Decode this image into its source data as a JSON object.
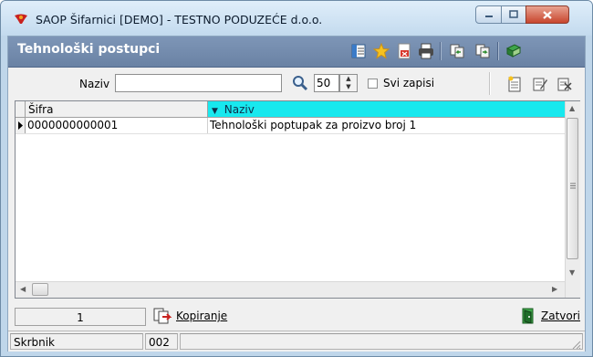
{
  "window": {
    "title": "SAOP Šifarnici [DEMO] - TESTNO PODUZEĆE d.o.o."
  },
  "header": {
    "title": "Tehnološki postupci"
  },
  "toolbar_icons": [
    "list-columns-icon",
    "star-icon",
    "pdf-icon",
    "printer-icon",
    "copy-left-icon",
    "copy-right-icon",
    "exit-book-icon"
  ],
  "filter": {
    "naziv_label": "Naziv",
    "naziv_value": "",
    "limit_value": "50",
    "svi_zapisi_label": "Svi zapisi",
    "svi_zapisi_checked": false
  },
  "grid": {
    "columns": [
      "Šifra",
      "Naziv"
    ],
    "sort_column": "Naziv",
    "sort_indicator": "▼",
    "rows": [
      {
        "sifra": "0000000000001",
        "naziv": "Tehnološki poptupak za proizvo broj 1"
      }
    ]
  },
  "bottom": {
    "record_number": "1",
    "kopiranje_label": "Kopiranje",
    "zatvori_label": "Zatvori"
  },
  "status": {
    "cell1": "Skrbnik",
    "cell2": "002",
    "cell3": ""
  },
  "colors": {
    "titlebar": "#c3daee",
    "header": "#6a82a4",
    "sorted_column": "#18e8ee"
  }
}
